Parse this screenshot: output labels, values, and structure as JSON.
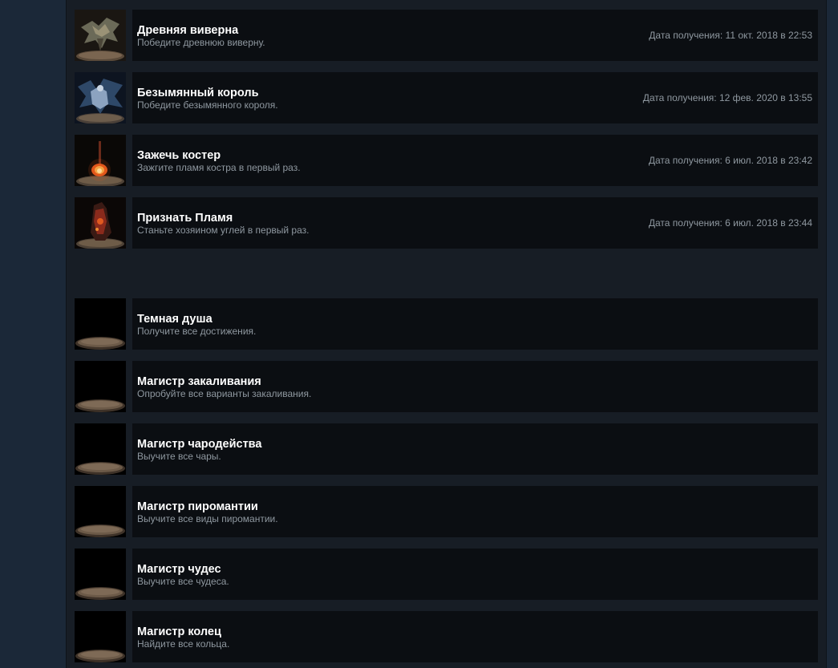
{
  "unlocked": [
    {
      "title": "Древняя виверна",
      "description": "Победите древнюю виверну.",
      "date": "Дата получения: 11 окт. 2018 в 22:53",
      "icon": "wyvern-icon"
    },
    {
      "title": "Безымянный король",
      "description": "Победите безымянного короля.",
      "date": "Дата получения: 12 фев. 2020 в 13:55",
      "icon": "nameless-king-icon"
    },
    {
      "title": "Зажечь костер",
      "description": "Зажгите пламя костра в первый раз.",
      "date": "Дата получения: 6 июл. 2018 в 23:42",
      "icon": "bonfire-icon"
    },
    {
      "title": "Признать Пламя",
      "description": "Станьте хозяином углей в первый раз.",
      "date": "Дата получения: 6 июл. 2018 в 23:44",
      "icon": "ember-knight-icon"
    }
  ],
  "locked": [
    {
      "title": "Темная душа",
      "description": "Получите все достижения.",
      "icon": "locked-pedestal-icon"
    },
    {
      "title": "Магистр закаливания",
      "description": "Опробуйте все варианты закаливания.",
      "icon": "locked-pedestal-icon"
    },
    {
      "title": "Магистр чародейства",
      "description": "Выучите все чары.",
      "icon": "locked-pedestal-icon"
    },
    {
      "title": "Магистр пиромантии",
      "description": "Выучите все виды пиромантии.",
      "icon": "locked-pedestal-icon"
    },
    {
      "title": "Магистр чудес",
      "description": "Выучите все чудеса.",
      "icon": "locked-pedestal-icon"
    },
    {
      "title": "Магистр колец",
      "description": "Найдите все кольца.",
      "icon": "locked-pedestal-icon"
    }
  ],
  "colors": {
    "page_bg": "#1b2838",
    "panel_bg": "#171d25",
    "row_bg": "#0b0e12",
    "title": "#ffffff",
    "text_muted": "#8f98a0"
  }
}
